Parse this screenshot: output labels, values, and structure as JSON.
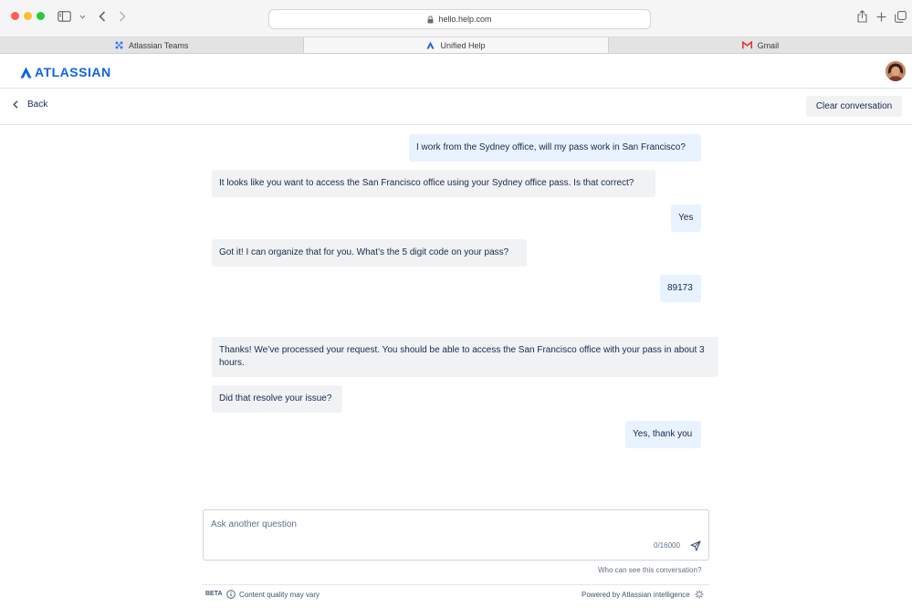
{
  "browser": {
    "url": "hello.help.com",
    "tabs": [
      {
        "label": "Atlassian Teams",
        "icon": "atlassian-teams-icon"
      },
      {
        "label": "Unified Help",
        "icon": "atlassian-logo-icon"
      },
      {
        "label": "Gmail",
        "icon": "gmail-icon"
      }
    ]
  },
  "header": {
    "brand": "ATLASSIAN",
    "brand_color": "#0c66e4"
  },
  "subheader": {
    "back_label": "Back",
    "clear_label": "Clear conversation"
  },
  "conversation": {
    "messages": [
      {
        "role": "user",
        "text": "I work from the Sydney office, will my pass work in San Francisco?"
      },
      {
        "role": "bot",
        "text": "It looks like you want to access the San Francisco office using your Sydney office pass. Is that correct?"
      },
      {
        "role": "user",
        "text": "Yes"
      },
      {
        "role": "bot",
        "text": "Got it! I can organize that for you. What’s the 5 digit code on your pass?"
      },
      {
        "role": "user",
        "text": "89173"
      },
      {
        "role": "bot",
        "text": "Thanks! We’ve processed your request. You should be able to access the San Francisco office with your pass in about 3 hours."
      },
      {
        "role": "bot",
        "text": "Did that resolve your issue?"
      },
      {
        "role": "user",
        "text": "Yes, thank you"
      }
    ]
  },
  "composer": {
    "placeholder": "Ask another question",
    "counter": "0/16000",
    "who_can_see": "Who can see this conversation?"
  },
  "footer": {
    "beta": "BETA",
    "quality_note": "Content quality may vary",
    "powered_by": "Powered by Atlassian intelligence"
  },
  "colors": {
    "user_bubble": "#e9f2ff",
    "bot_bubble": "#f1f2f4"
  }
}
